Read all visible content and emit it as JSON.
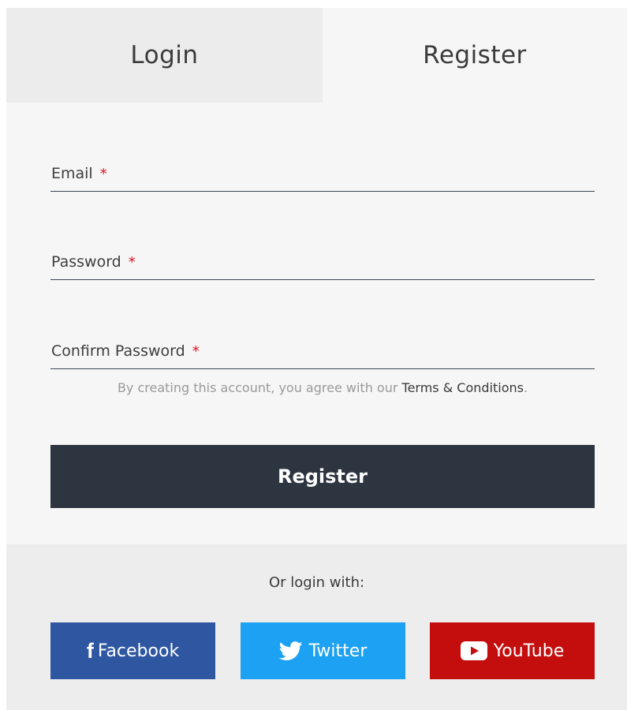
{
  "tabs": {
    "login": "Login",
    "register": "Register"
  },
  "form": {
    "email_label": "Email",
    "password_label": "Password",
    "confirm_password_label": "Confirm Password",
    "required_mark": "*",
    "terms_prefix": "By creating this account, you agree with our ",
    "terms_link": "Terms & Conditions",
    "terms_suffix": ".",
    "submit_label": "Register"
  },
  "social": {
    "or_text": "Or login with:",
    "facebook_icon_glyph": "f",
    "facebook": "Facebook",
    "twitter": "Twitter",
    "youtube": "YouTube",
    "icons": {
      "facebook": "facebook-icon",
      "twitter": "twitter-icon",
      "youtube": "youtube-icon"
    }
  },
  "colors": {
    "accent_dark": "#2d3541",
    "required": "#e0141e",
    "facebook": "#2f57a1",
    "twitter": "#1da1f2",
    "youtube": "#c40e0e"
  }
}
